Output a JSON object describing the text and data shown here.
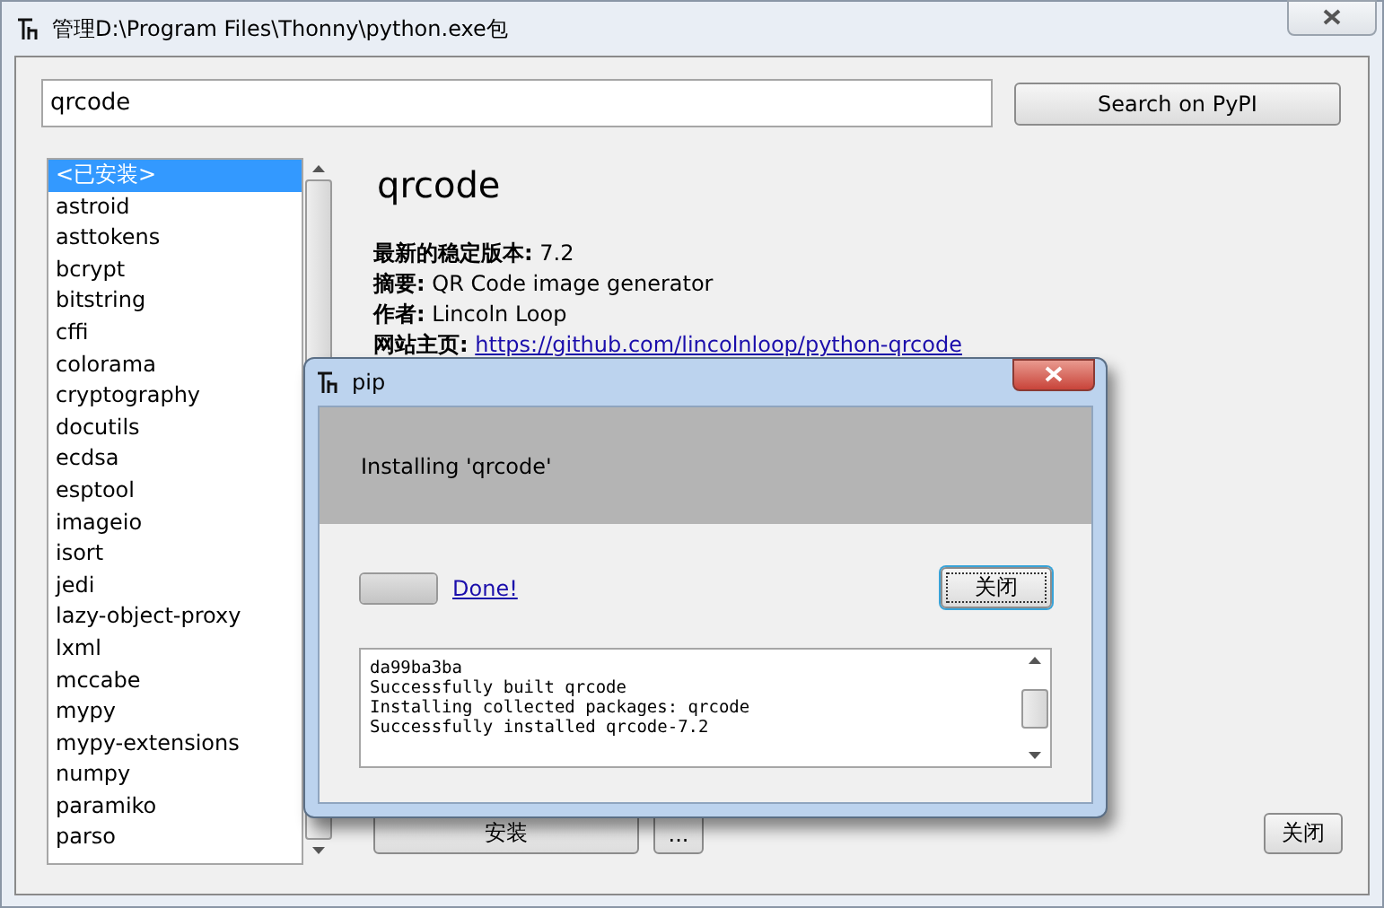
{
  "window": {
    "title": "管理D:\\Program Files\\Thonny\\python.exe包"
  },
  "search": {
    "value": "qrcode",
    "button": "Search on PyPI"
  },
  "packages": [
    {
      "name": "<已安装>",
      "selected": true
    },
    {
      "name": "astroid",
      "selected": false
    },
    {
      "name": "asttokens",
      "selected": false
    },
    {
      "name": "bcrypt",
      "selected": false
    },
    {
      "name": "bitstring",
      "selected": false
    },
    {
      "name": "cffi",
      "selected": false
    },
    {
      "name": "colorama",
      "selected": false
    },
    {
      "name": "cryptography",
      "selected": false
    },
    {
      "name": "docutils",
      "selected": false
    },
    {
      "name": "ecdsa",
      "selected": false
    },
    {
      "name": "esptool",
      "selected": false
    },
    {
      "name": "imageio",
      "selected": false
    },
    {
      "name": "isort",
      "selected": false
    },
    {
      "name": "jedi",
      "selected": false
    },
    {
      "name": "lazy-object-proxy",
      "selected": false
    },
    {
      "name": "lxml",
      "selected": false
    },
    {
      "name": "mccabe",
      "selected": false
    },
    {
      "name": "mypy",
      "selected": false
    },
    {
      "name": "mypy-extensions",
      "selected": false
    },
    {
      "name": "numpy",
      "selected": false
    },
    {
      "name": "paramiko",
      "selected": false
    },
    {
      "name": "parso",
      "selected": false
    }
  ],
  "details": {
    "title": "qrcode",
    "fields": [
      {
        "kind": "text",
        "label": "最新的稳定版本:",
        "value": "7.2"
      },
      {
        "kind": "text",
        "label": "摘要:",
        "value": "QR Code image generator"
      },
      {
        "kind": "text",
        "label": "作者:",
        "value": "Lincoln Loop"
      },
      {
        "kind": "link",
        "label": "网站主页:",
        "value": "https://github.com/lincolnloop/python-qrcode"
      }
    ]
  },
  "actions": {
    "install": "安装",
    "more": "...",
    "close": "关闭"
  },
  "dialog": {
    "title": "pip",
    "status": "Installing 'qrcode'",
    "progress": {
      "level": 1
    },
    "done_link": "Done!",
    "close": "关闭",
    "log": [
      "da99ba3ba",
      "Successfully built qrcode",
      "Installing collected packages: qrcode",
      "Successfully installed qrcode-7.2"
    ]
  }
}
